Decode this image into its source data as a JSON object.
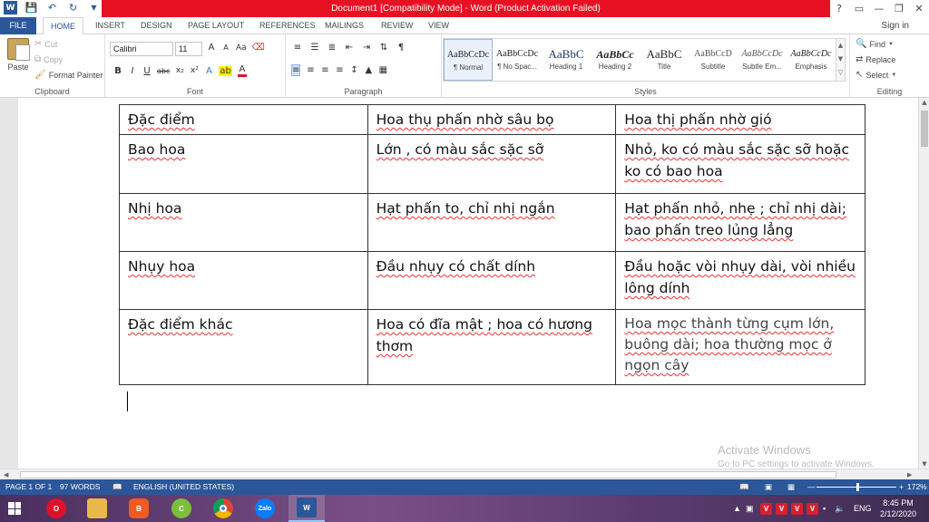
{
  "window": {
    "title": "Document1 [Compatibility Mode] - Word (Product Activation Failed)",
    "controls": [
      "?",
      "▭",
      "—",
      "❐",
      "✕"
    ]
  },
  "qat": {
    "icons": [
      "word-logo-icon",
      "save-icon",
      "undo-icon",
      "redo-icon",
      "customize-icon"
    ]
  },
  "tabs": {
    "file": "FILE",
    "items": [
      "HOME",
      "INSERT",
      "DESIGN",
      "PAGE LAYOUT",
      "REFERENCES",
      "MAILINGS",
      "REVIEW",
      "VIEW"
    ],
    "active": "HOME",
    "signin": "Sign in"
  },
  "ribbon": {
    "clipboard": {
      "label": "Clipboard",
      "paste": "Paste",
      "cut": "Cut",
      "copy": "Copy",
      "format_painter": "Format Painter"
    },
    "font": {
      "label": "Font",
      "family": "Calibri",
      "size": "11",
      "grow": "A",
      "shrink": "A",
      "case": "Aa",
      "bold": "B",
      "italic": "I",
      "underline": "U",
      "strike": "abc",
      "subscript": "x₂",
      "superscript": "x²",
      "text_effects": "A",
      "font_color": "A"
    },
    "paragraph": {
      "label": "Paragraph",
      "pilcrow": "¶"
    },
    "styles": {
      "label": "Styles",
      "items": [
        {
          "preview": "AaBbCcDc",
          "name": "¶ Normal"
        },
        {
          "preview": "AaBbCcDc",
          "name": "¶ No Spac..."
        },
        {
          "preview": "AaBbC",
          "name": "Heading 1"
        },
        {
          "preview": "AaBbCc",
          "name": "Heading 2"
        },
        {
          "preview": "AaBbC",
          "name": "Title"
        },
        {
          "preview": "AaBbCcD",
          "name": "Subtitle"
        },
        {
          "preview": "AaBbCcDc",
          "name": "Subtle Em..."
        },
        {
          "preview": "AaBbCcDc",
          "name": "Emphasis"
        }
      ]
    },
    "editing": {
      "label": "Editing",
      "find": "Find",
      "replace": "Replace",
      "select": "Select"
    }
  },
  "table": {
    "rows": [
      [
        "Đặc điểm",
        "Hoa thụ phấn nhờ sâu bọ",
        "Hoa thị phấn nhờ gió"
      ],
      [
        "Bao hoa",
        "Lớn , có màu sắc sặc sỡ",
        "Nhỏ, ko có màu sắc sặc sỡ hoặc ko có bao hoa"
      ],
      [
        "Nhị hoa",
        "Hạt phấn to, chỉ nhị ngắn",
        "Hạt phấn nhỏ, nhẹ ; chỉ nhị dài; bao phấn treo lủng lẳng"
      ],
      [
        "Nhụy hoa",
        "Đầu nhụy có chất dính",
        "Đầu hoặc vòi nhụy dài, vòi nhiều lông dính"
      ],
      [
        "Đặc điểm khác",
        "Hoa có đĩa mật ; hoa có hương thơm",
        "Hoa mọc thành từng cụm lớn, buông dài; hoa thường mọc ở ngọn cây"
      ]
    ]
  },
  "watermark": {
    "line1": "Activate Windows",
    "line2": "Go to PC settings to activate Windows."
  },
  "status": {
    "page": "PAGE 1 OF 1",
    "words": "97 WORDS",
    "language": "ENGLISH (UNITED STATES)",
    "zoom": "172%"
  },
  "taskbar": {
    "apps": [
      {
        "name": "opera",
        "label": "O",
        "color": "#e0102a"
      },
      {
        "name": "file-explorer",
        "label": "",
        "color": "#e8b84a"
      },
      {
        "name": "brave",
        "label": "B",
        "color": "#f05a24"
      },
      {
        "name": "coccoc",
        "label": "C",
        "color": "#7bbf3b"
      },
      {
        "name": "chrome",
        "label": "",
        "color": "#4285f4"
      },
      {
        "name": "zalo",
        "label": "Zalo",
        "color": "#0a7cff"
      },
      {
        "name": "word",
        "label": "W",
        "color": "#2b579a"
      }
    ],
    "language": "ENG",
    "time": "8:45 PM",
    "date": "2/12/2020"
  }
}
